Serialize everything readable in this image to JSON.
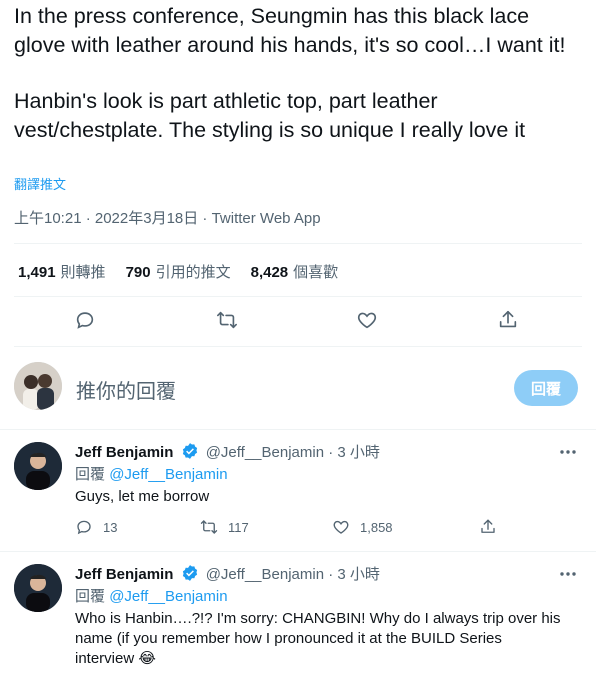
{
  "tweet": {
    "paragraph1": "In the press conference, Seungmin has this black lace glove with leather around his hands, it's so cool…I want it!",
    "paragraph2": "Hanbin's look is part athletic top, part leather vest/chestplate. The styling is so unique I really love it",
    "translate_label": "翻譯推文",
    "timestamp": "上午10:21 · 2022年3月18日 · Twitter Web App",
    "stats": {
      "retweets_count": "1,491",
      "retweets_label": "則轉推",
      "quotes_count": "790",
      "quotes_label": "引用的推文",
      "likes_count": "8,428",
      "likes_label": "個喜歡"
    }
  },
  "compose": {
    "placeholder": "推你的回覆",
    "reply_button": "回覆"
  },
  "replies": [
    {
      "name": "Jeff Benjamin",
      "handle": "@Jeff__Benjamin · 3 小時",
      "replying_label": "回覆",
      "replying_to": "@Jeff__Benjamin",
      "text": "Guys, let me borrow",
      "reply_count": "13",
      "retweet_count": "117",
      "like_count": "1,858"
    },
    {
      "name": "Jeff Benjamin",
      "handle": "@Jeff__Benjamin · 3 小時",
      "replying_label": "回覆",
      "replying_to": "@Jeff__Benjamin",
      "text": "Who is Hanbin….?!? I'm sorry: CHANGBIN! Why do I always trip over his name (if you remember how I pronounced it at the BUILD Series interview 😂"
    }
  ],
  "colors": {
    "accent": "#1d9bf0",
    "muted": "#536471",
    "text": "#0f1419",
    "reply_button_disabled": "#8ecdf7"
  },
  "icons": [
    "reply-icon",
    "retweet-icon",
    "like-icon",
    "share-icon",
    "verified-badge-icon",
    "more-options-icon"
  ]
}
